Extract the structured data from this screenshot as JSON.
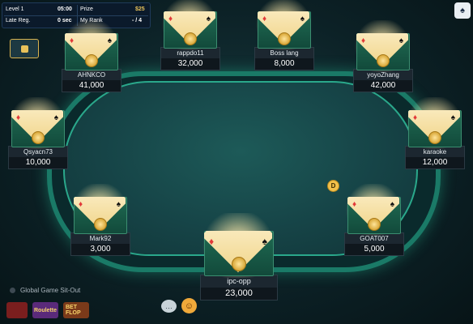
{
  "info": {
    "level_label": "Level 1",
    "level_time": "05:00",
    "prize_label": "Prize",
    "prize_value": "$25",
    "late_reg_label": "Late Reg.",
    "late_reg_value": "0 sec",
    "my_rank_label": "My Rank",
    "my_rank_value": "- / 4"
  },
  "seats": [
    {
      "name": "rappdo11",
      "stack": "32,000"
    },
    {
      "name": "Boss lang",
      "stack": "8,000"
    },
    {
      "name": "AHNKCO",
      "stack": "41,000"
    },
    {
      "name": "yoyoZhang",
      "stack": "42,000"
    },
    {
      "name": "Qsyacn73",
      "stack": "10,000"
    },
    {
      "name": "karaoke",
      "stack": "12,000"
    },
    {
      "name": "Mark92",
      "stack": "3,000"
    },
    {
      "name": "GOAT007",
      "stack": "5,000"
    },
    {
      "name": "ipc-opp",
      "stack": "23,000"
    }
  ],
  "dealer_label": "D",
  "footer": {
    "sit_out_label": "Global Game Sit-Out",
    "games": [
      "",
      "Roulette",
      "BET FLOP"
    ]
  },
  "icons": {
    "corner": "card-deck-icon",
    "menu": "menu-icon",
    "chat": "chat-icon",
    "emoji": "emoji-icon"
  },
  "colors": {
    "felt": "#164447",
    "rail_glow": "#2aa88b",
    "gold": "#e8c25a"
  }
}
